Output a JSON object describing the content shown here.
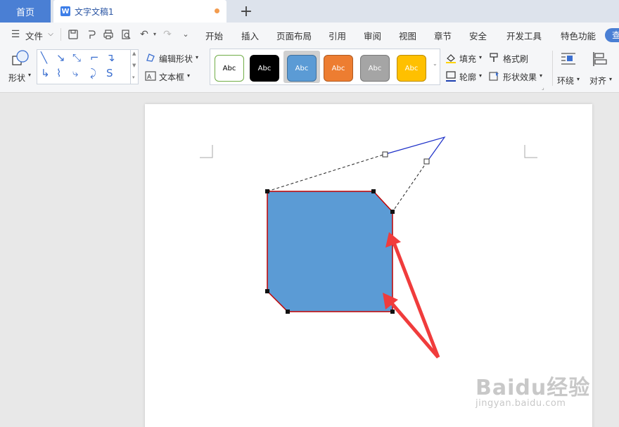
{
  "tabs": {
    "home_label": "首页",
    "doc_icon_letter": "W",
    "doc_title": "文字文稿1",
    "add_symbol": "+"
  },
  "menubar": {
    "file_label": "文件",
    "items": [
      "开始",
      "插入",
      "页面布局",
      "引用",
      "审阅",
      "视图",
      "章节",
      "安全",
      "开发工具",
      "特色功能"
    ],
    "pill_label": "查"
  },
  "ribbon": {
    "shape_label": "形状",
    "edit_shape_label": "编辑形状",
    "textbox_label": "文本框",
    "style_swatches": [
      {
        "label": "Abc",
        "bg": "#ffffff",
        "fg": "#000000",
        "border": "#70ad47"
      },
      {
        "label": "Abc",
        "bg": "#000000",
        "fg": "#ffffff",
        "border": "#000000"
      },
      {
        "label": "Abc",
        "bg": "#5b9bd5",
        "fg": "#ffffff",
        "border": "#41719c"
      },
      {
        "label": "Abc",
        "bg": "#ed7d31",
        "fg": "#ffffff",
        "border": "#ae5a21"
      },
      {
        "label": "Abc",
        "bg": "#a5a5a5",
        "fg": "#ffffff",
        "border": "#787878"
      },
      {
        "label": "Abc",
        "bg": "#ffc000",
        "fg": "#ffffff",
        "border": "#bc8c00"
      }
    ],
    "fill_label": "填充",
    "format_painter_label": "格式刷",
    "outline_label": "轮廓",
    "shape_effects_label": "形状效果",
    "wrap_label": "环绕",
    "align_label": "对齐"
  },
  "document": {
    "shape_fill": "#5b9bd5",
    "shape_outline": "#c00000",
    "arrow_color": "#f03c3c",
    "watermark_logo": "Baidu经验",
    "watermark_url": "jingyan.baidu.com"
  }
}
